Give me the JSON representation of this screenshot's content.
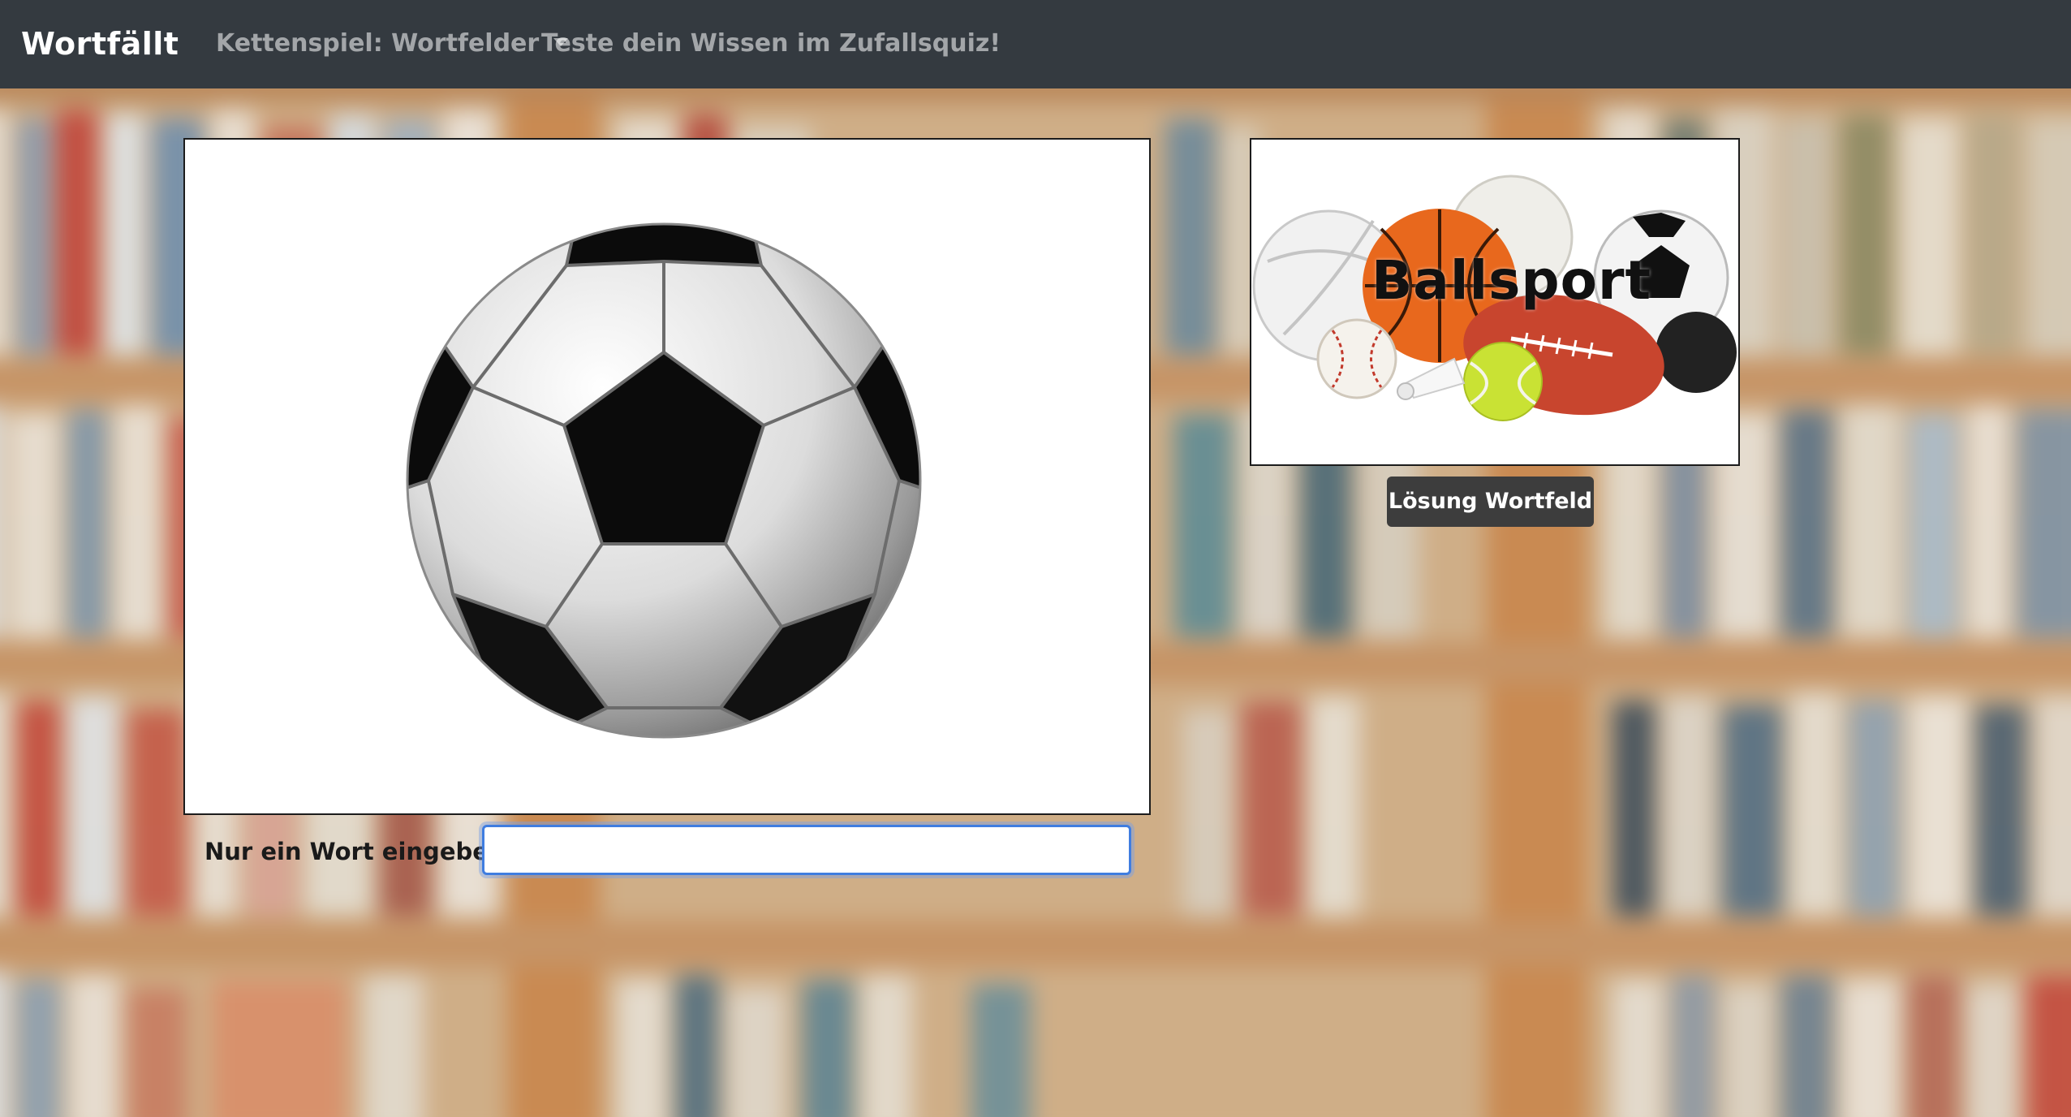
{
  "navbar": {
    "brand": "Wortfällt",
    "dropdown_label": "Kettenspiel: Wortfelder",
    "quiz_link": "Teste dein Wissen im Zufallsquiz!"
  },
  "game": {
    "input_label": "Nur ein Wort eingeben:",
    "input_value": "",
    "input_placeholder": ""
  },
  "solution": {
    "thumbnail_title": "Ballsport",
    "button_label": "Lösung Wortfeld"
  },
  "colors": {
    "navbar_bg": "#343a40",
    "brand_text": "#ffffff",
    "nav_link_text": "rgba(255,255,255,0.55)",
    "button_bg": "#3d3d3d",
    "input_focus_border": "#3f7de0"
  },
  "icons": {
    "dropdown": "caret-down-icon"
  }
}
